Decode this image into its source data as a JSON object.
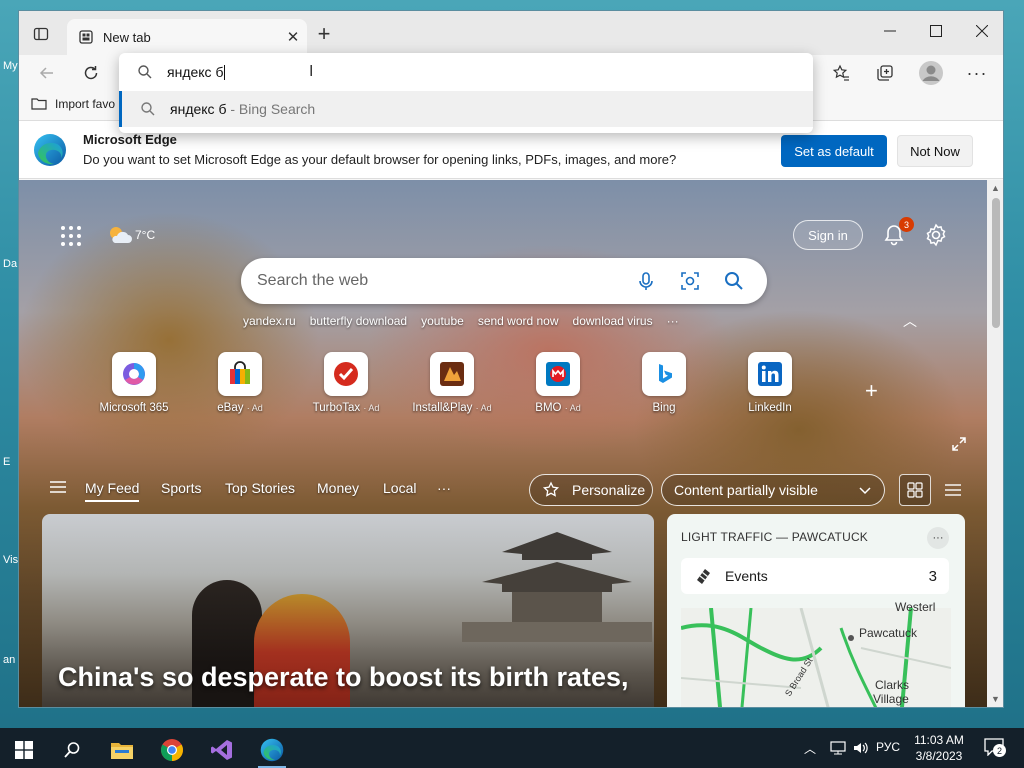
{
  "desktop": {
    "edge_labels": [
      "My",
      "Da",
      "E",
      "Vis",
      "an"
    ]
  },
  "browser": {
    "tab": {
      "title": "New tab"
    },
    "favorites_bar": {
      "import_label": "Import favo"
    },
    "omnibox": {
      "value": "яндекс б",
      "suggestion_text": "яндекс б",
      "suggestion_suffix": " - Bing Search"
    },
    "infobar": {
      "title": "Microsoft Edge",
      "message": "Do you want to set Microsoft Edge as your default browser for opening links, PDFs, images, and more?",
      "primary_label": "Set as default",
      "secondary_label": "Not Now",
      "primary_color": "#0067c0"
    }
  },
  "ntp": {
    "weather": "7°C",
    "sign_in": "Sign in",
    "notification_count": "3",
    "search_placeholder": "Search the web",
    "quick_links": [
      "yandex.ru",
      "butterfly download",
      "youtube",
      "send word now",
      "download virus",
      "···"
    ],
    "tiles": [
      {
        "label": "Microsoft 365",
        "ad": ""
      },
      {
        "label": "eBay",
        "ad": "· Ad"
      },
      {
        "label": "TurboTax",
        "ad": "· Ad"
      },
      {
        "label": "Install&Play",
        "ad": "· Ad"
      },
      {
        "label": "BMO",
        "ad": "· Ad"
      },
      {
        "label": "Bing",
        "ad": ""
      },
      {
        "label": "LinkedIn",
        "ad": ""
      }
    ],
    "feed_nav": {
      "items": [
        "My Feed",
        "Sports",
        "Top Stories",
        "Money",
        "Local",
        "···"
      ],
      "personalize": "Personalize",
      "content_visibility": "Content partially visible"
    },
    "news": {
      "headline": "China's so desperate to boost its birth rates,"
    },
    "traffic": {
      "title": "LIGHT TRAFFIC — PAWCATUCK",
      "events_label": "Events",
      "events_count": "3",
      "map_labels": [
        "Westerl",
        "Pawcatuck",
        "Clarks",
        "Village",
        "S Broad St"
      ]
    }
  },
  "taskbar": {
    "language": "РУС",
    "time": "11:03 AM",
    "date": "3/8/2023",
    "notification_count": "2"
  }
}
